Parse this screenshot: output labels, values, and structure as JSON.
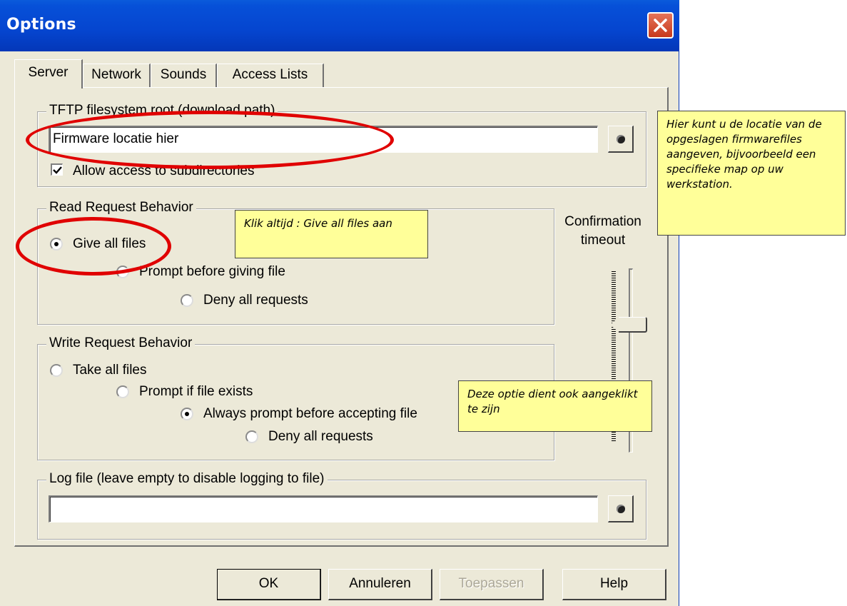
{
  "window": {
    "title": "Options"
  },
  "tabs": [
    {
      "label": "Server",
      "active": true
    },
    {
      "label": "Network",
      "active": false
    },
    {
      "label": "Sounds",
      "active": false
    },
    {
      "label": "Access Lists",
      "active": false
    }
  ],
  "tftp_root": {
    "legend": "TFTP filesystem root (download path)",
    "value": "Firmware locatie hier",
    "allow_subdirs_label": "Allow access to subdirectories",
    "allow_subdirs_checked": true
  },
  "read_request": {
    "legend": "Read Request Behavior",
    "options": [
      {
        "label": "Give all files",
        "checked": true
      },
      {
        "label": "Prompt before giving file",
        "checked": false
      },
      {
        "label": "Deny all requests",
        "checked": false
      }
    ]
  },
  "write_request": {
    "legend": "Write Request Behavior",
    "options": [
      {
        "label": "Take all files",
        "checked": false
      },
      {
        "label": "Prompt if file exists",
        "checked": false
      },
      {
        "label": "Always prompt before accepting file",
        "checked": true
      },
      {
        "label": "Deny all requests",
        "checked": false
      }
    ]
  },
  "confirmation": {
    "label_line1": "Confirmation",
    "label_line2": "timeout"
  },
  "log_file": {
    "legend": "Log file (leave empty to disable logging to file)",
    "value": ""
  },
  "buttons": {
    "ok": "OK",
    "cancel": "Annuleren",
    "apply": "Toepassen",
    "help": "Help"
  },
  "notes": {
    "location": "Hier kunt u de locatie van de opgeslagen firmwarefiles aangeven, bijvoorbeeld een specifieke map op uw werkstation.",
    "give_all": "Klik altijd : Give all files aan",
    "always_prompt": "Deze optie dient ook aangeklikt te zijn"
  },
  "colors": {
    "titlebar": "#0545cf",
    "dialog_bg": "#ece9d8",
    "note_bg": "#ffff99",
    "highlight_ellipse": "#e00000"
  },
  "icons": [
    "close-icon",
    "folder-browse-icon",
    "checkmark-icon"
  ]
}
